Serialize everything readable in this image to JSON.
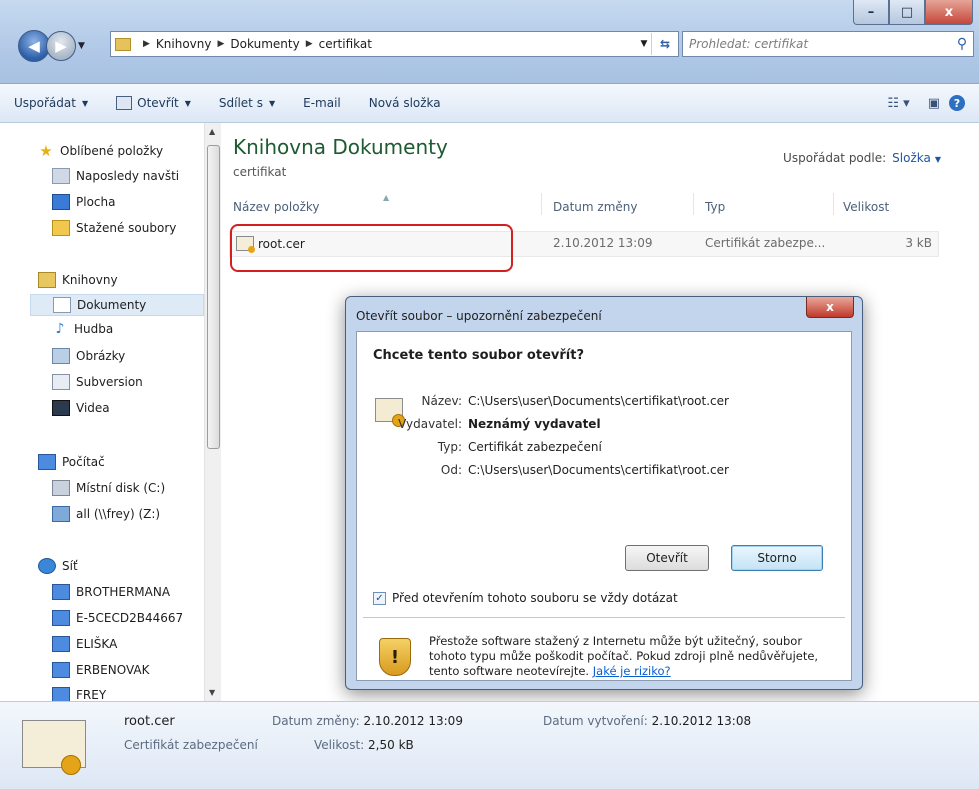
{
  "window": {
    "buttons": {
      "minimize": "–",
      "maximize": "□",
      "close": "x"
    }
  },
  "address": {
    "breadcrumbs": [
      "Knihovny",
      "Dokumenty",
      "certifikat"
    ]
  },
  "search": {
    "placeholder": "Prohledat: certifikat"
  },
  "toolbar": {
    "organize": "Uspořádat",
    "open": "Otevřít",
    "share": "Sdílet s",
    "email": "E-mail",
    "new_folder": "Nová složka",
    "help": "?"
  },
  "nav": {
    "favorites": "Oblíbené položky",
    "recent": "Naposledy navšti",
    "desktop": "Plocha",
    "downloads": "Stažené soubory",
    "libraries": "Knihovny",
    "documents": "Dokumenty",
    "music": "Hudba",
    "pictures": "Obrázky",
    "subversion": "Subversion",
    "videos": "Videa",
    "computer": "Počítač",
    "local_disk": "Místní disk (C:)",
    "network_drive": "all (\\\\frey) (Z:)",
    "network": "Síť",
    "hosts": [
      "BROTHERMANA",
      "E-5CECD2B44667",
      "ELIŠKA",
      "ERBENOVAK",
      "FREY"
    ]
  },
  "main": {
    "title": "Knihovna Dokumenty",
    "subtitle": "certifikat",
    "arrange_label": "Uspořádat podle:",
    "arrange_value": "Složka",
    "columns": {
      "name": "Název položky",
      "date": "Datum změny",
      "type": "Typ",
      "size": "Velikost"
    },
    "files": [
      {
        "name": "root.cer",
        "date": "2.10.2012 13:09",
        "type": "Certifikát zabezpe...",
        "size": "3 kB"
      }
    ]
  },
  "dialog": {
    "title": "Otevřít soubor – upozornění zabezpečení",
    "close": "x",
    "question": "Chcete tento soubor otevřít?",
    "fields": [
      {
        "label": "Název:",
        "value": "C:\\Users\\user\\Documents\\certifikat\\root.cer"
      },
      {
        "label": "Vydavatel:",
        "value": "Neznámý vydavatel"
      },
      {
        "label": "Typ:",
        "value": "Certifikát zabezpečení"
      },
      {
        "label": "Od:",
        "value": "C:\\Users\\user\\Documents\\certifikat\\root.cer"
      }
    ],
    "open_button": "Otevřít",
    "cancel_button": "Storno",
    "checkbox_label": "Před otevřením tohoto souboru se vždy dotázat",
    "checkbox_checked": true,
    "warning_text": "Přestože software stažený z Internetu může být užitečný, soubor tohoto typu může poškodit počítač. Pokud zdroji plně nedůvěřujete, tento software neotevírejte.",
    "warning_link": "Jaké je riziko?"
  },
  "details": {
    "name": "root.cer",
    "type": "Certifikát zabezpečení",
    "modified_label": "Datum změny:",
    "modified": "2.10.2012 13:09",
    "size_label": "Velikost:",
    "size": "2,50 kB",
    "created_label": "Datum vytvoření:",
    "created": "2.10.2012 13:08"
  }
}
